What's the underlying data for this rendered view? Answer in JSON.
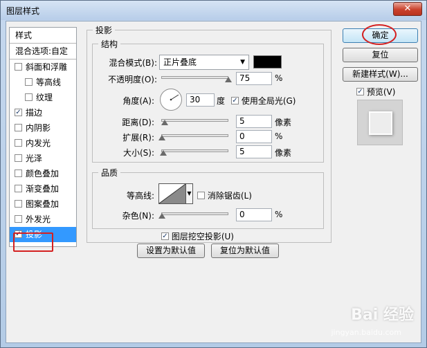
{
  "window": {
    "title": "图层样式",
    "close_glyph": "✕"
  },
  "sidebar": {
    "header": "样式",
    "blend_options": "混合选项:自定",
    "items": [
      {
        "label": "斜面和浮雕",
        "checked": false,
        "sub": false
      },
      {
        "label": "等高线",
        "checked": false,
        "sub": true
      },
      {
        "label": "纹理",
        "checked": false,
        "sub": true
      },
      {
        "label": "描边",
        "checked": true,
        "sub": false
      },
      {
        "label": "内阴影",
        "checked": false,
        "sub": false
      },
      {
        "label": "内发光",
        "checked": false,
        "sub": false
      },
      {
        "label": "光泽",
        "checked": false,
        "sub": false
      },
      {
        "label": "颜色叠加",
        "checked": false,
        "sub": false
      },
      {
        "label": "渐变叠加",
        "checked": false,
        "sub": false
      },
      {
        "label": "图案叠加",
        "checked": false,
        "sub": false
      },
      {
        "label": "外发光",
        "checked": false,
        "sub": false
      },
      {
        "label": "投影",
        "checked": true,
        "sub": false,
        "selected": true
      }
    ]
  },
  "shadow": {
    "title": "投影",
    "structure": {
      "title": "结构",
      "blend_mode_label": "混合模式(B):",
      "blend_mode_value": "正片叠底",
      "color": "#000000",
      "opacity_label": "不透明度(O):",
      "opacity_value": "75",
      "opacity_unit": "%",
      "angle_label": "角度(A):",
      "angle_value": "30",
      "angle_unit": "度",
      "global_light_label": "使用全局光(G)",
      "global_light_checked": true,
      "distance_label": "距离(D):",
      "distance_value": "5",
      "distance_unit": "像素",
      "spread_label": "扩展(R):",
      "spread_value": "0",
      "spread_unit": "%",
      "size_label": "大小(S):",
      "size_value": "5",
      "size_unit": "像素"
    },
    "quality": {
      "title": "品质",
      "contour_label": "等高线:",
      "antialias_label": "消除锯齿(L)",
      "antialias_checked": false,
      "noise_label": "杂色(N):",
      "noise_value": "0",
      "noise_unit": "%"
    },
    "knockout_label": "图层挖空投影(U)",
    "knockout_checked": true,
    "make_default": "设置为默认值",
    "reset_default": "复位为默认值"
  },
  "buttons": {
    "ok": "确定",
    "reset": "复位",
    "new_style": "新建样式(W)...",
    "preview_label": "预览(V)",
    "preview_checked": true
  },
  "watermark": {
    "brand": "Bai 经验",
    "url": "jingyan.baidu.com"
  },
  "accent": {
    "selection": "#3399ff",
    "highlight_red": "#d42020"
  }
}
